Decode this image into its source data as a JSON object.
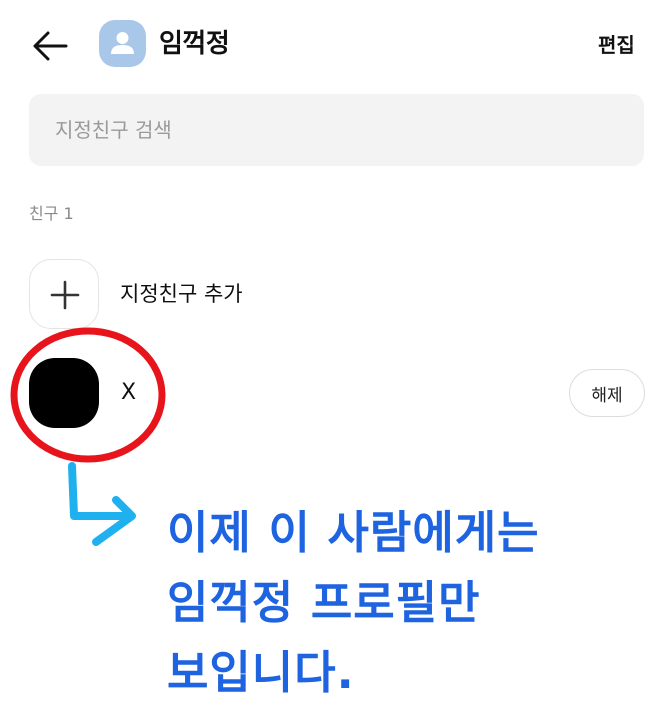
{
  "header": {
    "back_icon": "arrow-left-icon",
    "profile_icon": "person-icon",
    "title": "임꺽정",
    "edit_label": "편집"
  },
  "search": {
    "placeholder": "지정친구 검색",
    "value": ""
  },
  "section": {
    "label": "친구 1"
  },
  "add_friend": {
    "icon": "plus-icon",
    "label": "지정친구 추가"
  },
  "friends": [
    {
      "name": "X",
      "action_label": "해제"
    }
  ],
  "annotation": {
    "line1": "이제 이 사람에게는",
    "line2": "임꺽정 프로필만",
    "line3": "보입니다.",
    "text_color": "#1e63e0",
    "circle_color": "#e8141c",
    "arrow_color": "#1fb0f0"
  }
}
